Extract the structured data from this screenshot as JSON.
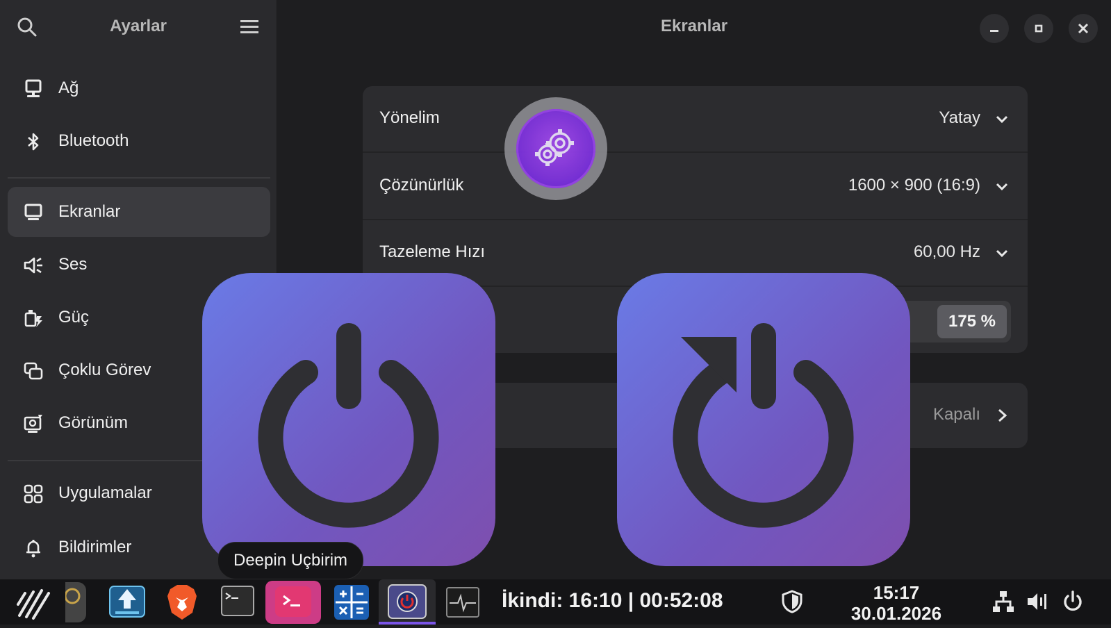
{
  "sidebar": {
    "title": "Ayarlar",
    "items": [
      {
        "label": "Ağ",
        "icon": "network-icon"
      },
      {
        "label": "Bluetooth",
        "icon": "bluetooth-icon"
      },
      {
        "label": "Ekranlar",
        "icon": "display-icon",
        "active": true
      },
      {
        "label": "Ses",
        "icon": "sound-icon"
      },
      {
        "label": "Güç",
        "icon": "power-plug-icon"
      },
      {
        "label": "Çoklu Görev",
        "icon": "multitasking-icon"
      },
      {
        "label": "Görünüm",
        "icon": "appearance-icon"
      },
      {
        "label": "Uygulamalar",
        "icon": "apps-grid-icon"
      },
      {
        "label": "Bildirimler",
        "icon": "bell-icon"
      }
    ]
  },
  "main": {
    "title": "Ekranlar",
    "rows": {
      "orientation": {
        "label": "Yönelim",
        "value": "Yatay"
      },
      "resolution": {
        "label": "Çözünürlük",
        "value": "1600 × 900 (16:9)"
      },
      "refresh": {
        "label": "Tazeleme Hızı",
        "value": "60,00 Hz"
      },
      "scale": {
        "prev_label": "%",
        "active_label": "175 %"
      },
      "night_light": {
        "value": "Kapalı"
      }
    }
  },
  "overlay": {
    "left_icon": "power-off-icon",
    "right_icon": "restart-icon",
    "gear_icon": "settings-gear-icon",
    "tooltip": "Deepin Uçbirim"
  },
  "taskbar": {
    "prayer_text": "İkindi: 16:10 | 00:52:08",
    "time": "15:17",
    "date": "30.01.2026",
    "colors": {
      "accent": "#7b55e8",
      "osd_start": "#6a7be6",
      "osd_end": "#7e4fae"
    }
  }
}
